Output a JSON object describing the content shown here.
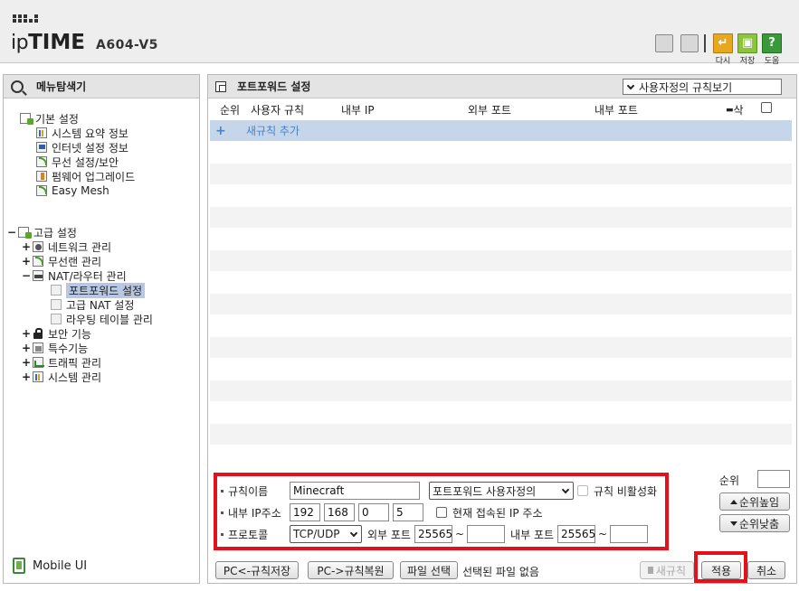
{
  "header": {
    "brand_prefix": "ip",
    "brand_big": "TIME",
    "model": "A604-V5",
    "buttons": [
      {
        "name": "reload",
        "label": "다시",
        "color": "#e6a820"
      },
      {
        "name": "save",
        "label": "저장",
        "color": "#8cc43c"
      },
      {
        "name": "help",
        "label": "도움",
        "color": "#3a9a3a"
      }
    ]
  },
  "sidebar": {
    "title": "메뉴탐색기",
    "basic_group": "기본 설정",
    "basic_items": [
      "시스템 요약 정보",
      "인터넷 설정 정보",
      "무선 설정/보안",
      "펌웨어 업그레이드",
      "Easy Mesh"
    ],
    "advanced_group": "고급 설정",
    "advanced_items": {
      "network": "네트워크 관리",
      "wireless": "무선랜 관리",
      "nat": "NAT/라우터 관리",
      "nat_children": [
        "포트포워드 설정",
        "고급 NAT 설정",
        "라우팅 테이블 관리"
      ],
      "security": "보안 기능",
      "special": "특수기능",
      "traffic": "트래픽 관리",
      "system": "시스템 관리"
    },
    "expand_plus": "+",
    "expand_minus": "−",
    "mobile_ui": "Mobile UI"
  },
  "main": {
    "title": "포트포워드 설정",
    "view_select": "사용자정의 규칙보기",
    "columns": {
      "order": "순위",
      "user_rule": "사용자 규칙",
      "internal_ip": "내부 IP",
      "external_port": "외부 포트",
      "internal_port": "내부 포트",
      "delete": "삭제"
    },
    "new_rule_plus": "+",
    "new_rule": "새규칙 추가",
    "form": {
      "rule_name_label": "규칙이름",
      "rule_name_value": "Minecraft",
      "rule_type_value": "포트포워드 사용자정의",
      "disable_rule_label": "규칙 비활성화",
      "internal_ip_label": "내부 IP주소",
      "ip": [
        "192",
        "168",
        "0",
        "5"
      ],
      "current_ip_label": "현재 접속된 IP 주소",
      "protocol_label": "프로토콜",
      "protocol_value": "TCP/UDP",
      "ext_port_label": "외부 포트",
      "ext_port_from": "25565",
      "ext_port_to": "",
      "int_port_label": "내부 포트",
      "int_port_from": "25565",
      "int_port_to": "",
      "tilde": "~"
    },
    "order_label": "순위",
    "priority_up": "순위높임",
    "priority_down": "순위낮춤",
    "bottom": {
      "pc_save": "PC<-규칙저장",
      "pc_restore": "PC->규칙복원",
      "file_select": "파일 선택",
      "file_note": "선택된 파일 없음",
      "new_rule_btn": "새규칙",
      "apply": "적용",
      "cancel": "취소"
    },
    "highlight_color": "#e4101a"
  }
}
